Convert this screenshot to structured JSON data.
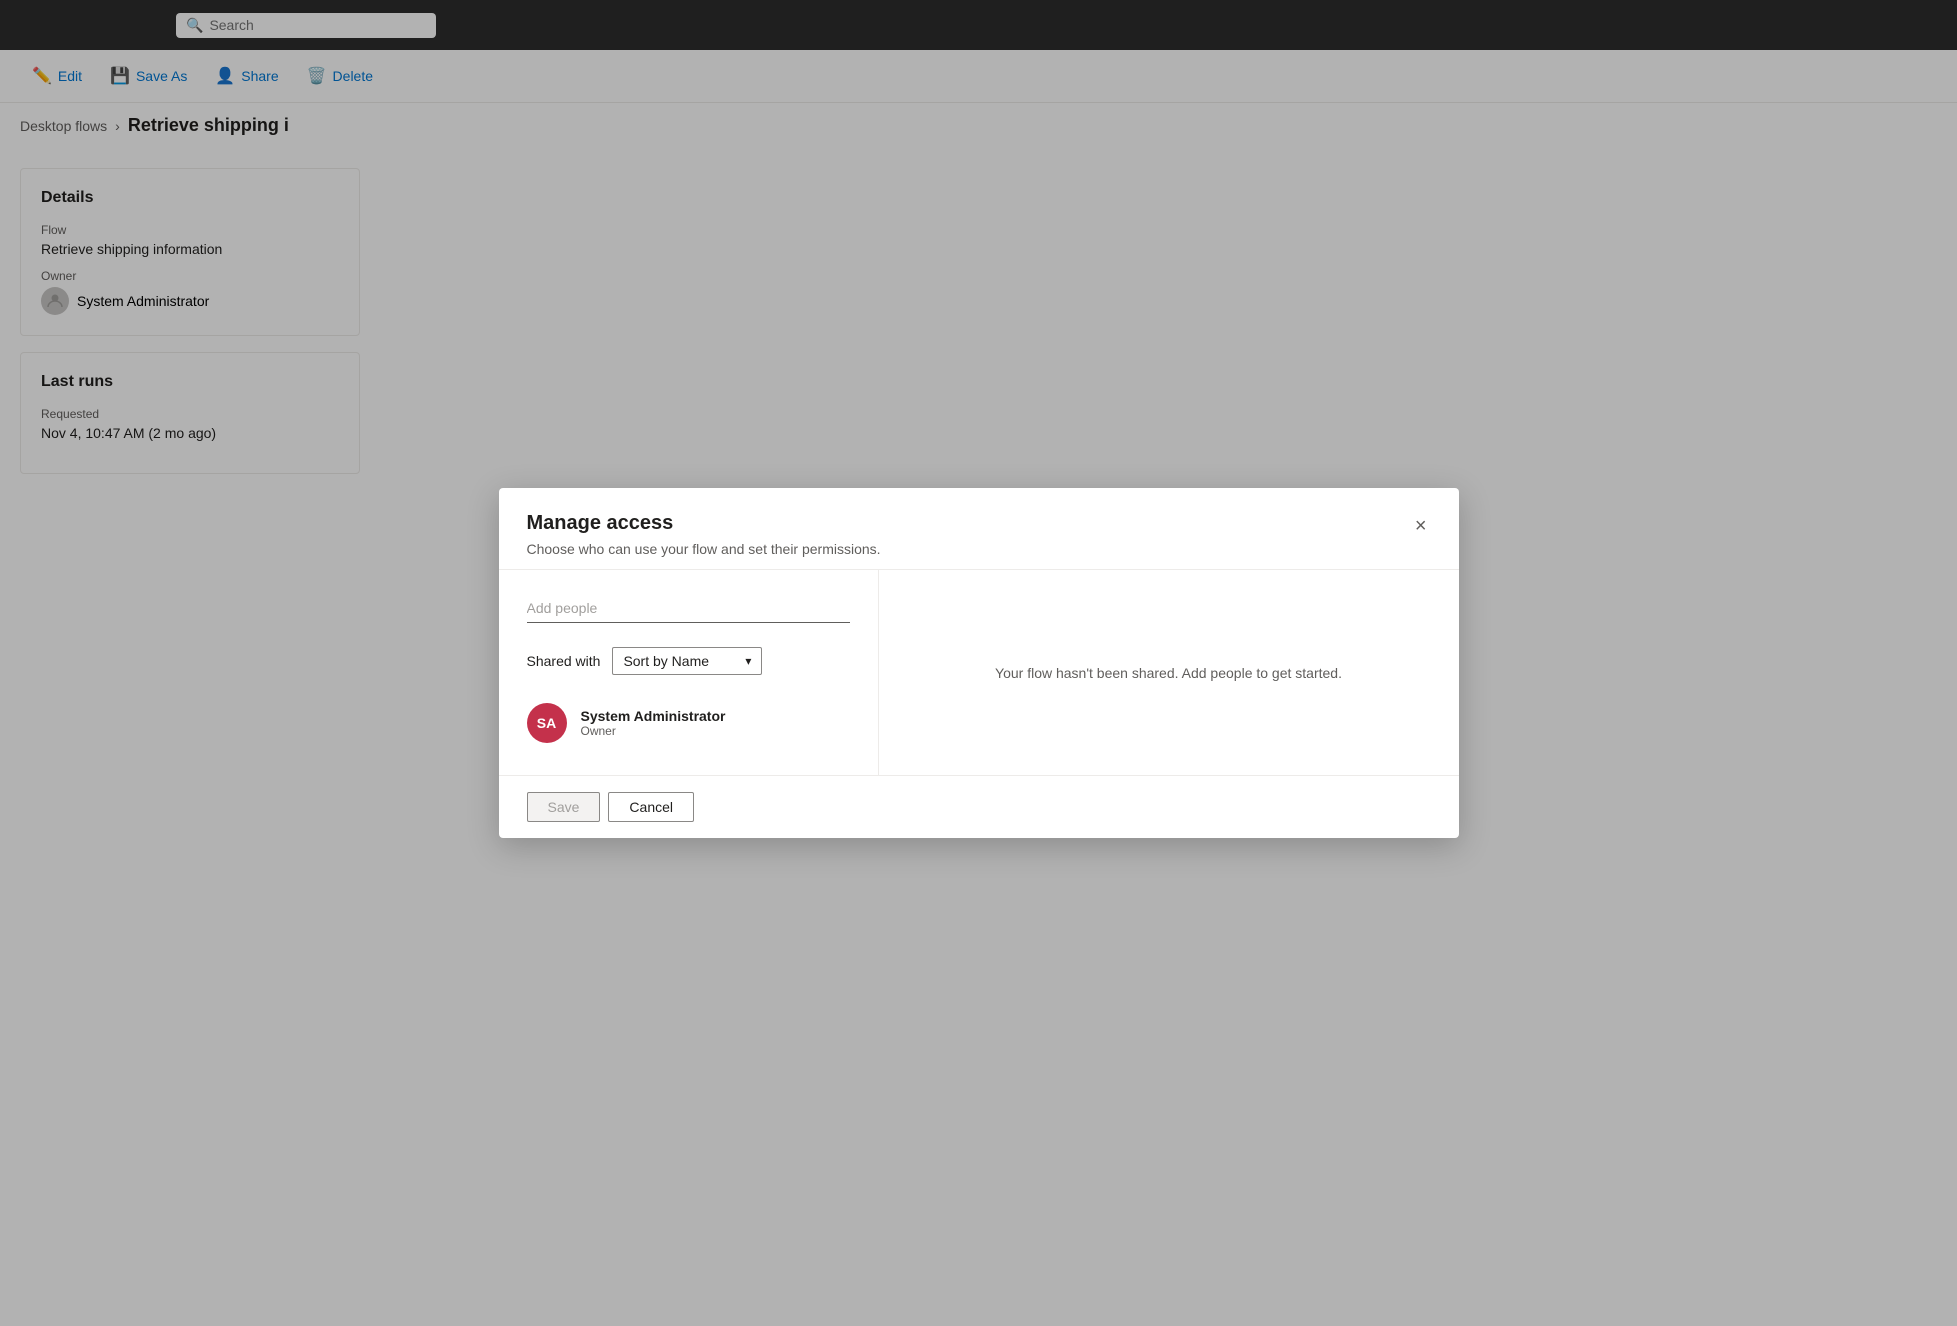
{
  "topbar": {
    "search_placeholder": "Search"
  },
  "toolbar": {
    "edit_label": "Edit",
    "saveas_label": "Save As",
    "share_label": "Share",
    "delete_label": "Delete"
  },
  "breadcrumb": {
    "parent": "Desktop flows",
    "current": "Retrieve shipping i"
  },
  "details_card": {
    "title": "Details",
    "flow_label": "Flow",
    "flow_value": "Retrieve shipping information",
    "owner_label": "Owner",
    "owner_value": "System Administrator"
  },
  "last_runs_card": {
    "title": "Last runs",
    "status_label": "Requested",
    "timestamp": "Nov 4, 10:47 AM (2 mo ago)"
  },
  "modal": {
    "title": "Manage access",
    "subtitle": "Choose who can use your flow and set their permissions.",
    "close_label": "×",
    "add_people_placeholder": "Add people",
    "shared_with_label": "Shared with",
    "sort_label": "Sort by Name",
    "system_admin_initials": "SA",
    "system_admin_name": "System Administrator",
    "system_admin_role": "Owner",
    "empty_message": "Your flow hasn't been shared. Add people to get started.",
    "save_label": "Save",
    "cancel_label": "Cancel"
  }
}
